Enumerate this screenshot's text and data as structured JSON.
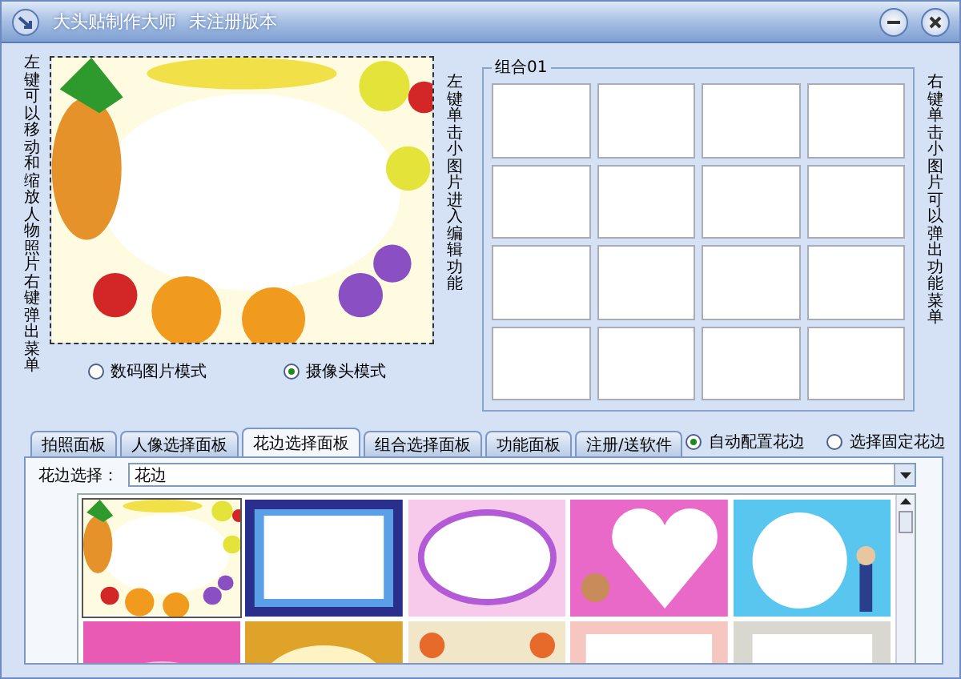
{
  "window": {
    "title": "大头贴制作大师",
    "subtitle": "未注册版本"
  },
  "left_hint": "左键可以移动和缩放人物照片右键弹出菜单",
  "preview": {
    "kind": "picture"
  },
  "mode_options": [
    {
      "label": "数码图片模式",
      "selected": false
    },
    {
      "label": "摄像头模式",
      "selected": true
    }
  ],
  "middle_hint": "左键单击小图片进入编辑功能",
  "group": {
    "title": "组合01"
  },
  "right_hint": "右键单击小图片可以弹出功能菜单",
  "tabs": [
    {
      "label": "拍照面板",
      "selected": false
    },
    {
      "label": "人像选择面板",
      "selected": false
    },
    {
      "label": "花边选择面板",
      "selected": true
    },
    {
      "label": "组合选择面板",
      "selected": false
    },
    {
      "label": "功能面板",
      "selected": false
    },
    {
      "label": "注册/送软件",
      "selected": false
    }
  ],
  "frame_options": [
    {
      "label": "自动配置花边",
      "selected": true
    },
    {
      "label": "选择固定花边",
      "selected": false
    }
  ],
  "frame_select": {
    "label": "花边选择：",
    "value": "花边"
  },
  "thumbnails": [
    {
      "kind": "picture",
      "selected": true
    },
    {
      "kind": "picture",
      "selected": false
    },
    {
      "kind": "picture",
      "selected": false
    },
    {
      "kind": "picture",
      "selected": false
    },
    {
      "kind": "picture",
      "selected": false
    },
    {
      "kind": "picture",
      "selected": false
    },
    {
      "kind": "picture",
      "selected": false
    },
    {
      "kind": "picture",
      "selected": false
    },
    {
      "kind": "picture",
      "selected": false
    },
    {
      "kind": "picture",
      "selected": false
    }
  ]
}
